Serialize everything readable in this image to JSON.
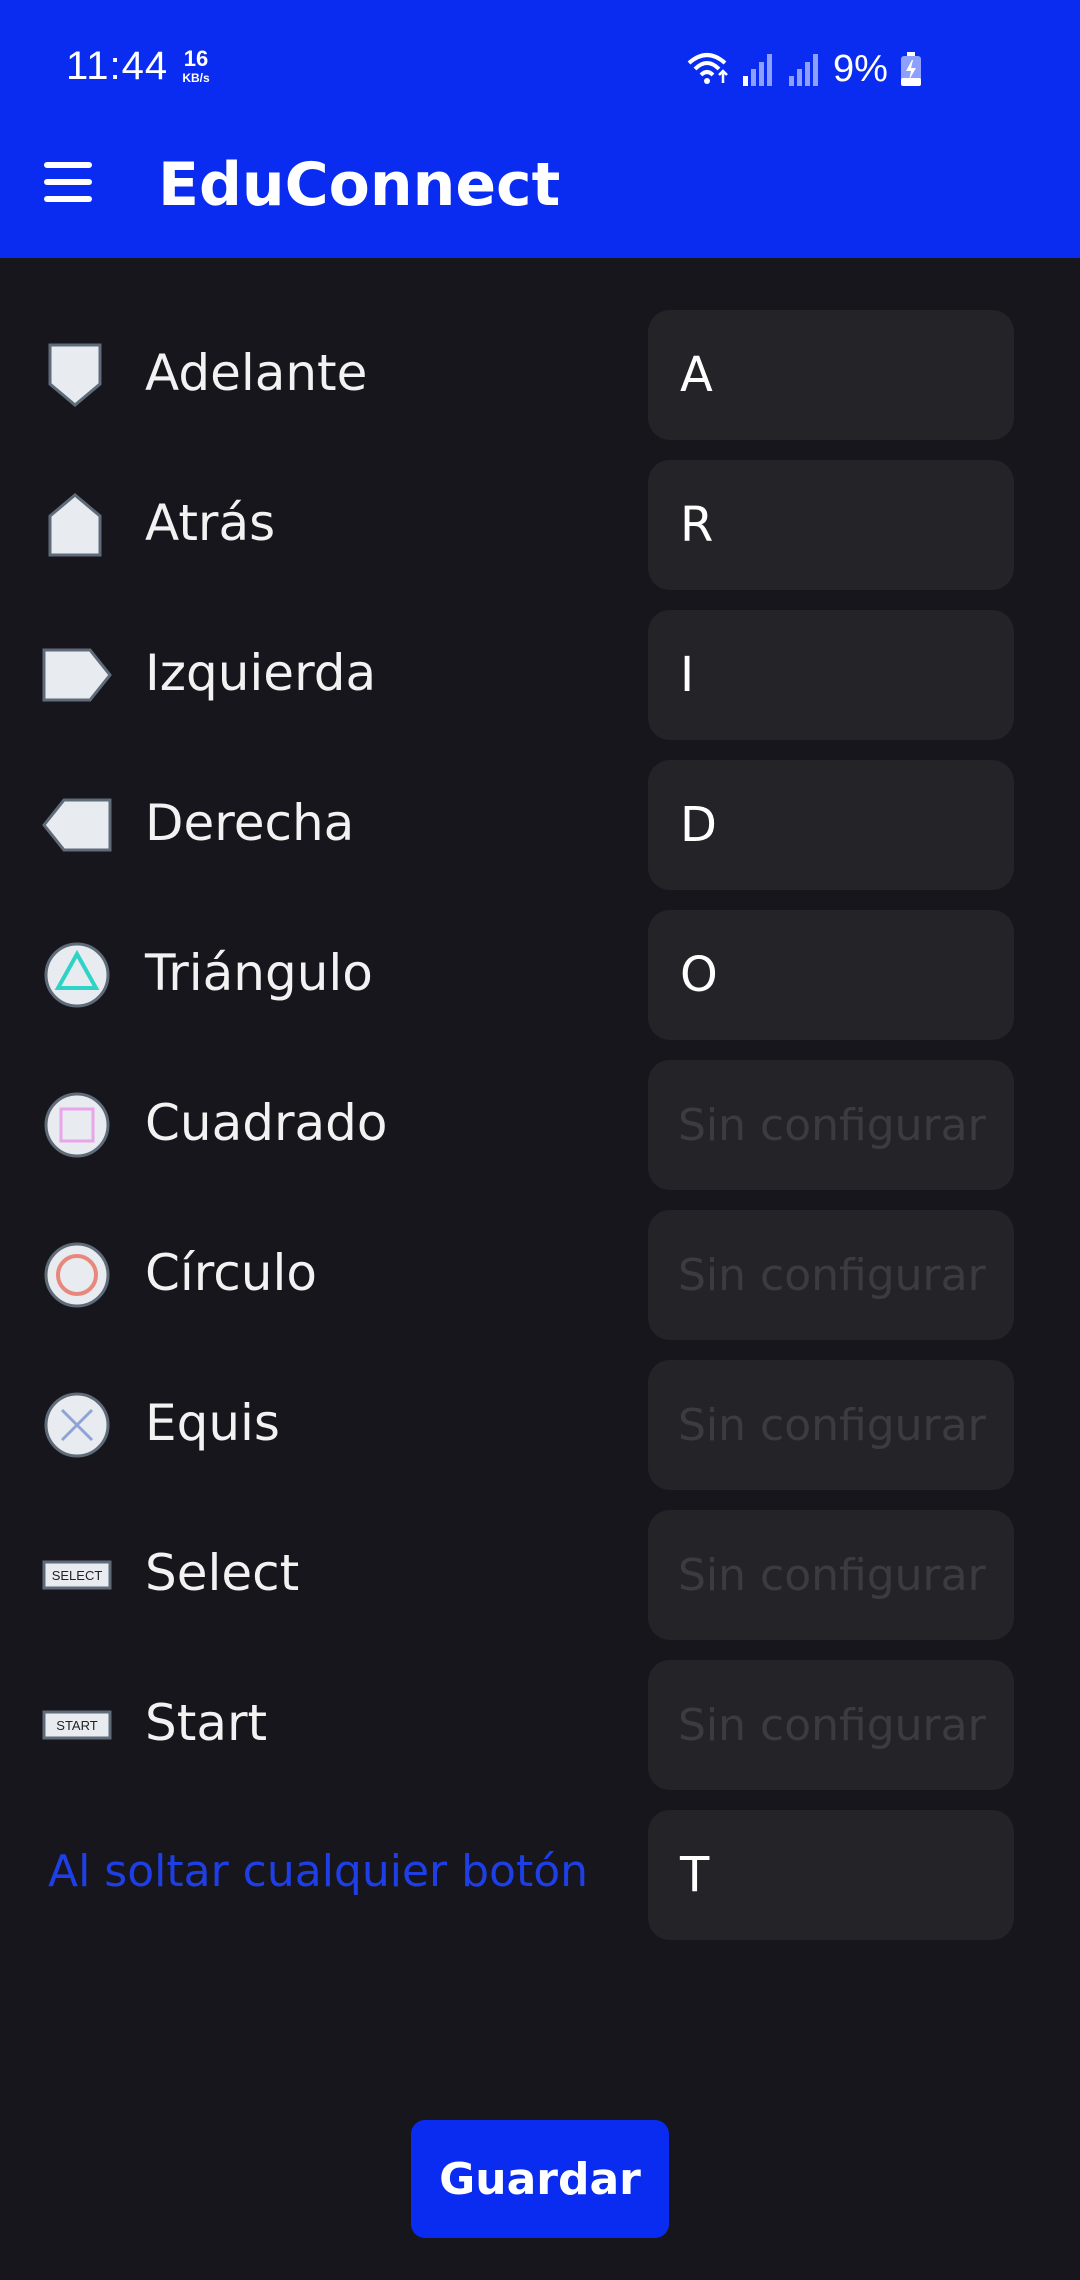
{
  "status_bar": {
    "time": "11:44",
    "net_speed_value": "16",
    "net_speed_unit": "KB/s",
    "battery_percent": "9%"
  },
  "app_bar": {
    "title": "EduConnect",
    "menu_icon": "menu-icon"
  },
  "mappings": [
    {
      "label": "Adelante",
      "value": "A",
      "icon": "arrow-up-icon"
    },
    {
      "label": "Atrás",
      "value": "R",
      "icon": "arrow-down-icon"
    },
    {
      "label": "Izquierda",
      "value": "I",
      "icon": "arrow-left-icon"
    },
    {
      "label": "Derecha",
      "value": "D",
      "icon": "arrow-right-icon"
    },
    {
      "label": "Triángulo",
      "value": "O",
      "icon": "triangle-button-icon"
    },
    {
      "label": "Cuadrado",
      "value": "",
      "placeholder": "Sin configurar",
      "icon": "square-button-icon"
    },
    {
      "label": "Círculo",
      "value": "",
      "placeholder": "Sin configurar",
      "icon": "circle-button-icon"
    },
    {
      "label": "Equis",
      "value": "",
      "placeholder": "Sin configurar",
      "icon": "cross-button-icon"
    },
    {
      "label": "Select",
      "value": "",
      "placeholder": "Sin configurar",
      "icon": "select-button-icon",
      "icon_text": "SELECT"
    },
    {
      "label": "Start",
      "value": "",
      "placeholder": "Sin configurar",
      "icon": "start-button-icon",
      "icon_text": "START"
    }
  ],
  "release": {
    "label": "Al soltar cualquier botón",
    "value": "T"
  },
  "save_button": {
    "label": "Guardar"
  },
  "colors": {
    "primary": "#0a2cf0",
    "background": "#17161c",
    "field": "#242328",
    "placeholder": "#3c3b42",
    "triangle": "#2ed3c6",
    "square": "#e8a6e8",
    "circle": "#e8887c",
    "cross": "#8fa3d6"
  }
}
